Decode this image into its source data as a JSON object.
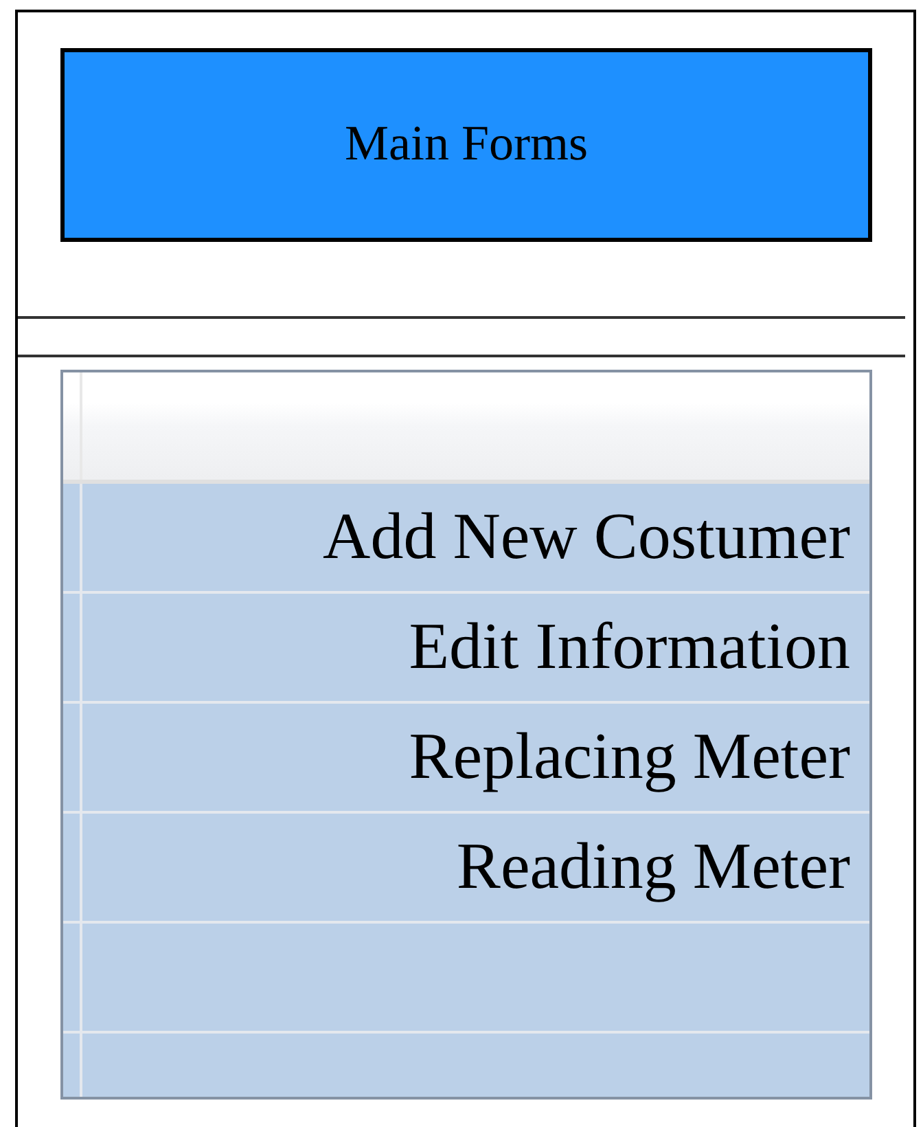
{
  "main_button": {
    "label": "Main Forms"
  },
  "grid": {
    "rows": [
      {
        "label": "Add New Costumer"
      },
      {
        "label": "Edit Information"
      },
      {
        "label": "Replacing Meter"
      },
      {
        "label": "Reading Meter"
      }
    ]
  }
}
